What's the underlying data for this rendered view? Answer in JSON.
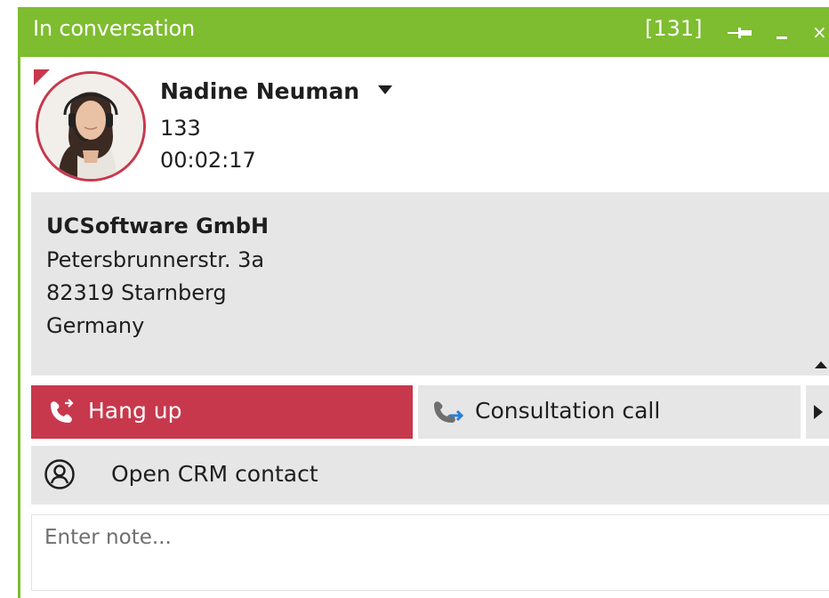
{
  "window": {
    "title": "In conversation",
    "line_number": "[131]",
    "accent_color": "#7dbd2f",
    "icons": {
      "pin": "pin-icon",
      "minimize": "minimize-icon",
      "close": "close-icon"
    },
    "close_glyph": "×"
  },
  "caller": {
    "name": "Nadine Neuman",
    "extension": "133",
    "duration": "00:02:17",
    "avatar_ring_color": "#c8384c"
  },
  "contact": {
    "company": "UCSoftware GmbH",
    "street": "Petersbrunnerstr. 3a",
    "city": "82319 Starnberg",
    "country": "Germany"
  },
  "actions": {
    "hang_up": {
      "label": "Hang up",
      "icon": "phone-hangup-icon",
      "color": "#c8384c"
    },
    "consultation": {
      "label": "Consultation call",
      "icon": "phone-forward-icon"
    },
    "more": {
      "icon": "chevron-right-icon"
    },
    "open_crm": {
      "label": "Open CRM contact",
      "icon": "user-circle-icon"
    }
  },
  "note": {
    "placeholder": "Enter note..."
  }
}
